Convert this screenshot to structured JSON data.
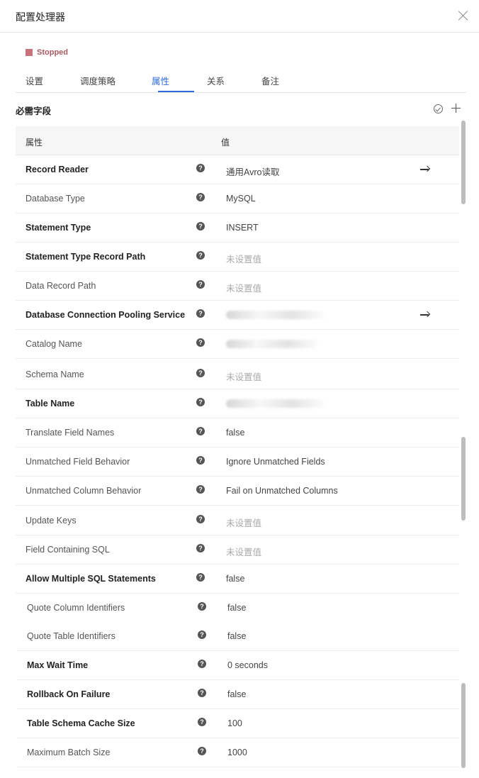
{
  "dialog": {
    "title": "配置处理器"
  },
  "status": {
    "label": "Stopped",
    "color": "#c9727a"
  },
  "tabs": [
    {
      "label": "设置",
      "active": false
    },
    {
      "label": "调度策略",
      "active": false
    },
    {
      "label": "属性",
      "active": true
    },
    {
      "label": "关系",
      "active": false
    },
    {
      "label": "备注",
      "active": false
    }
  ],
  "section": {
    "title": "必需字段",
    "icons": [
      "check-circle-icon",
      "plus-icon"
    ]
  },
  "table": {
    "headers": {
      "property": "属性",
      "value": "值"
    },
    "rows": [
      {
        "name": "Record Reader",
        "value": "通用Avro读取",
        "required": true,
        "unset": false,
        "redacted": false,
        "arrow": true
      },
      {
        "name": "Database Type",
        "value": "MySQL",
        "required": false,
        "unset": false,
        "redacted": false,
        "arrow": false
      },
      {
        "name": "Statement Type",
        "value": "INSERT",
        "required": true,
        "unset": false,
        "redacted": false,
        "arrow": false
      },
      {
        "name": "Statement Type Record Path",
        "value": "未设置值",
        "required": true,
        "unset": true,
        "redacted": false,
        "arrow": false
      },
      {
        "name": "Data Record Path",
        "value": "未设置值",
        "required": false,
        "unset": true,
        "redacted": false,
        "arrow": false
      },
      {
        "name": "Database Connection Pooling Service",
        "value": "",
        "required": true,
        "unset": false,
        "redacted": true,
        "arrow": true
      },
      {
        "name": "Catalog Name",
        "value": "",
        "required": false,
        "unset": false,
        "redacted": true,
        "arrow": false
      },
      {
        "name": "Schema Name",
        "value": "未设置值",
        "required": false,
        "unset": true,
        "redacted": false,
        "arrow": false
      },
      {
        "name": "Table Name",
        "value": "",
        "required": true,
        "unset": false,
        "redacted": true,
        "arrow": false
      },
      {
        "name": "Translate Field Names",
        "value": "false",
        "required": false,
        "unset": false,
        "redacted": false,
        "arrow": false
      },
      {
        "name": "Unmatched Field Behavior",
        "value": "Ignore Unmatched Fields",
        "required": false,
        "unset": false,
        "redacted": false,
        "arrow": false
      },
      {
        "name": "Unmatched Column Behavior",
        "value": "Fail on Unmatched Columns",
        "required": false,
        "unset": false,
        "redacted": false,
        "arrow": false
      },
      {
        "name": "Update Keys",
        "value": "未设置值",
        "required": false,
        "unset": true,
        "redacted": false,
        "arrow": false
      },
      {
        "name": "Field Containing SQL",
        "value": "未设置值",
        "required": false,
        "unset": true,
        "redacted": false,
        "arrow": false
      },
      {
        "name": "Allow Multiple SQL Statements",
        "value": "false",
        "required": true,
        "unset": false,
        "redacted": false,
        "arrow": false
      },
      {
        "name": "Quote Column Identifiers",
        "value": "false",
        "required": false,
        "unset": false,
        "redacted": false,
        "arrow": false
      },
      {
        "name": "Quote Table Identifiers",
        "value": "false",
        "required": false,
        "unset": false,
        "redacted": false,
        "arrow": false
      },
      {
        "name": "Max Wait Time",
        "value": "0 seconds",
        "required": true,
        "unset": false,
        "redacted": false,
        "arrow": false
      },
      {
        "name": "Rollback On Failure",
        "value": "false",
        "required": true,
        "unset": false,
        "redacted": false,
        "arrow": false
      },
      {
        "name": "Table Schema Cache Size",
        "value": "100",
        "required": true,
        "unset": false,
        "redacted": false,
        "arrow": false
      },
      {
        "name": "Maximum Batch Size",
        "value": "1000",
        "required": false,
        "unset": false,
        "redacted": false,
        "arrow": false
      }
    ]
  }
}
